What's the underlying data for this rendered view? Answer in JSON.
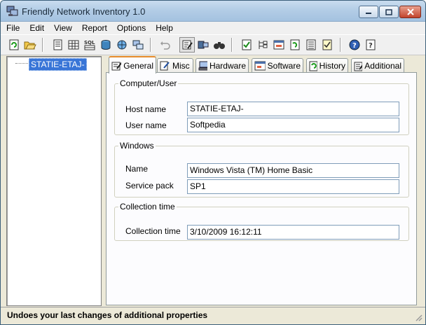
{
  "window": {
    "title": "Friendly Network Inventory 1.0"
  },
  "menu": [
    "File",
    "Edit",
    "View",
    "Report",
    "Options",
    "Help"
  ],
  "toolbar": {
    "buttons": [
      "refresh-icon",
      "open-folder-icon",
      "document-icon",
      "table-icon",
      "sql-icon",
      "database-icon",
      "network-icon",
      "computers-icon",
      "undo-icon",
      "edit-properties-icon",
      "view-computers-icon",
      "find-icon",
      "check-report-icon",
      "tree-report-icon",
      "window-report-icon",
      "changes-report-icon",
      "list-report-icon",
      "checklist-report-icon",
      "help-icon",
      "context-help-icon"
    ],
    "sql_label": "SQL"
  },
  "tree": {
    "selected_node": "STATIE-ETAJ-"
  },
  "tabs": [
    "General",
    "Misc",
    "Hardware",
    "Software",
    "History",
    "Additional"
  ],
  "active_tab": "General",
  "groups": {
    "computer_user": {
      "legend": "Computer/User",
      "host_label": "Host name",
      "host_value": "STATIE-ETAJ-",
      "user_label": "User name",
      "user_value": "Softpedia"
    },
    "windows": {
      "legend": "Windows",
      "name_label": "Name",
      "name_value": "Windows Vista (TM) Home Basic",
      "sp_label": "Service pack",
      "sp_value": "SP1"
    },
    "collection": {
      "legend": "Collection time",
      "time_label": "Collection time",
      "time_value": "3/10/2009 16:12:11"
    }
  },
  "status": {
    "text": "Undoes your last changes of additional properties"
  },
  "colors": {
    "selection": "#3875d7",
    "active_tab_accent": "#e68b2c",
    "input_border": "#7f9db9"
  }
}
